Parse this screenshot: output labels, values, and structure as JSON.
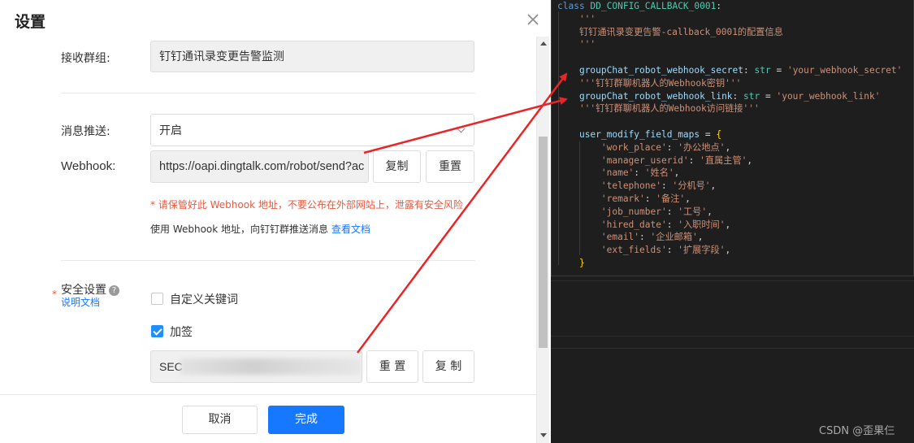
{
  "dialog": {
    "title": "设置",
    "close_icon": "close-icon",
    "group": {
      "label": "接收群组:",
      "value": "钉钉通讯录变更告警监测"
    },
    "push": {
      "label": "消息推送:",
      "value": "开启",
      "icon": "chevron-down-icon"
    },
    "webhook": {
      "label": "Webhook:",
      "value": "https://oapi.dingtalk.com/robot/send?ac",
      "copy_label": "复制",
      "reset_label": "重置"
    },
    "warning": "* 请保管好此 Webhook 地址，不要公布在外部网站上，泄露有安全风险",
    "hint_prefix": "使用 Webhook 地址，向钉钉群推送消息 ",
    "hint_link": "查看文档",
    "security": {
      "required_mark": "*",
      "label": "安全设置",
      "help_icon": "?",
      "doc_link": "说明文档",
      "keyword_label": "自定义关键词",
      "keyword_checked": false,
      "sign_label": "加签",
      "sign_checked": true,
      "secret_prefix": "SEC",
      "reset_label": "重 置",
      "copy_label": "复 制"
    },
    "footer": {
      "cancel_label": "取消",
      "done_label": "完成"
    }
  },
  "colors": {
    "primary": "#1677ff",
    "warning": "#e8573d",
    "arrow": "#e8262a",
    "code_bg": "#1e1e1e"
  },
  "code": {
    "lines": [
      [
        {
          "t": "class ",
          "c": "kw"
        },
        {
          "t": "DD_CONFIG_CALLBACK_0001",
          "c": "cls"
        },
        {
          "t": ":",
          "c": "op"
        }
      ],
      [
        {
          "t": "    '''",
          "c": "str"
        }
      ],
      [
        {
          "t": "    钉钉通讯录变更告警-callback_0001的配置信息",
          "c": "str"
        }
      ],
      [
        {
          "t": "    '''",
          "c": "str"
        }
      ],
      [],
      [
        {
          "t": "    ",
          "c": "op"
        },
        {
          "t": "groupChat_robot_webhook_secret",
          "c": "var"
        },
        {
          "t": ": ",
          "c": "op"
        },
        {
          "t": "str",
          "c": "cls"
        },
        {
          "t": " = ",
          "c": "op"
        },
        {
          "t": "'your_webhook_secret'",
          "c": "str"
        }
      ],
      [
        {
          "t": "    '''钉钉群聊机器人的Webhook密钥'''",
          "c": "str"
        }
      ],
      [
        {
          "t": "    ",
          "c": "op"
        },
        {
          "t": "groupChat_robot_webhook_link",
          "c": "var"
        },
        {
          "t": ": ",
          "c": "op"
        },
        {
          "t": "str",
          "c": "cls"
        },
        {
          "t": " = ",
          "c": "op"
        },
        {
          "t": "'your_webhook_link'",
          "c": "str"
        }
      ],
      [
        {
          "t": "    '''钉钉群聊机器人的Webhook访问链接'''",
          "c": "str"
        }
      ],
      [],
      [
        {
          "t": "    ",
          "c": "op"
        },
        {
          "t": "user_modify_field_maps",
          "c": "var"
        },
        {
          "t": " = ",
          "c": "op"
        },
        {
          "t": "{",
          "c": "brk"
        }
      ],
      [
        {
          "t": "        'work_place'",
          "c": "str"
        },
        {
          "t": ": ",
          "c": "op"
        },
        {
          "t": "'办公地点'",
          "c": "str"
        },
        {
          "t": ",",
          "c": "op"
        }
      ],
      [
        {
          "t": "        'manager_userid'",
          "c": "str"
        },
        {
          "t": ": ",
          "c": "op"
        },
        {
          "t": "'直属主管'",
          "c": "str"
        },
        {
          "t": ",",
          "c": "op"
        }
      ],
      [
        {
          "t": "        'name'",
          "c": "str"
        },
        {
          "t": ": ",
          "c": "op"
        },
        {
          "t": "'姓名'",
          "c": "str"
        },
        {
          "t": ",",
          "c": "op"
        }
      ],
      [
        {
          "t": "        'telephone'",
          "c": "str"
        },
        {
          "t": ": ",
          "c": "op"
        },
        {
          "t": "'分机号'",
          "c": "str"
        },
        {
          "t": ",",
          "c": "op"
        }
      ],
      [
        {
          "t": "        'remark'",
          "c": "str"
        },
        {
          "t": ": ",
          "c": "op"
        },
        {
          "t": "'备注'",
          "c": "str"
        },
        {
          "t": ",",
          "c": "op"
        }
      ],
      [
        {
          "t": "        'job_number'",
          "c": "str"
        },
        {
          "t": ": ",
          "c": "op"
        },
        {
          "t": "'工号'",
          "c": "str"
        },
        {
          "t": ",",
          "c": "op"
        }
      ],
      [
        {
          "t": "        'hired_date'",
          "c": "str"
        },
        {
          "t": ": ",
          "c": "op"
        },
        {
          "t": "'入职时间'",
          "c": "str"
        },
        {
          "t": ",",
          "c": "op"
        }
      ],
      [
        {
          "t": "        'email'",
          "c": "str"
        },
        {
          "t": ": ",
          "c": "op"
        },
        {
          "t": "'企业邮箱'",
          "c": "str"
        },
        {
          "t": ",",
          "c": "op"
        }
      ],
      [
        {
          "t": "        'ext_fields'",
          "c": "str"
        },
        {
          "t": ": ",
          "c": "op"
        },
        {
          "t": "'扩展字段'",
          "c": "str"
        },
        {
          "t": ",",
          "c": "op"
        }
      ],
      [
        {
          "t": "    ",
          "c": "op"
        },
        {
          "t": "}",
          "c": "brk"
        }
      ]
    ]
  },
  "watermark": "CSDN @歪果仨"
}
